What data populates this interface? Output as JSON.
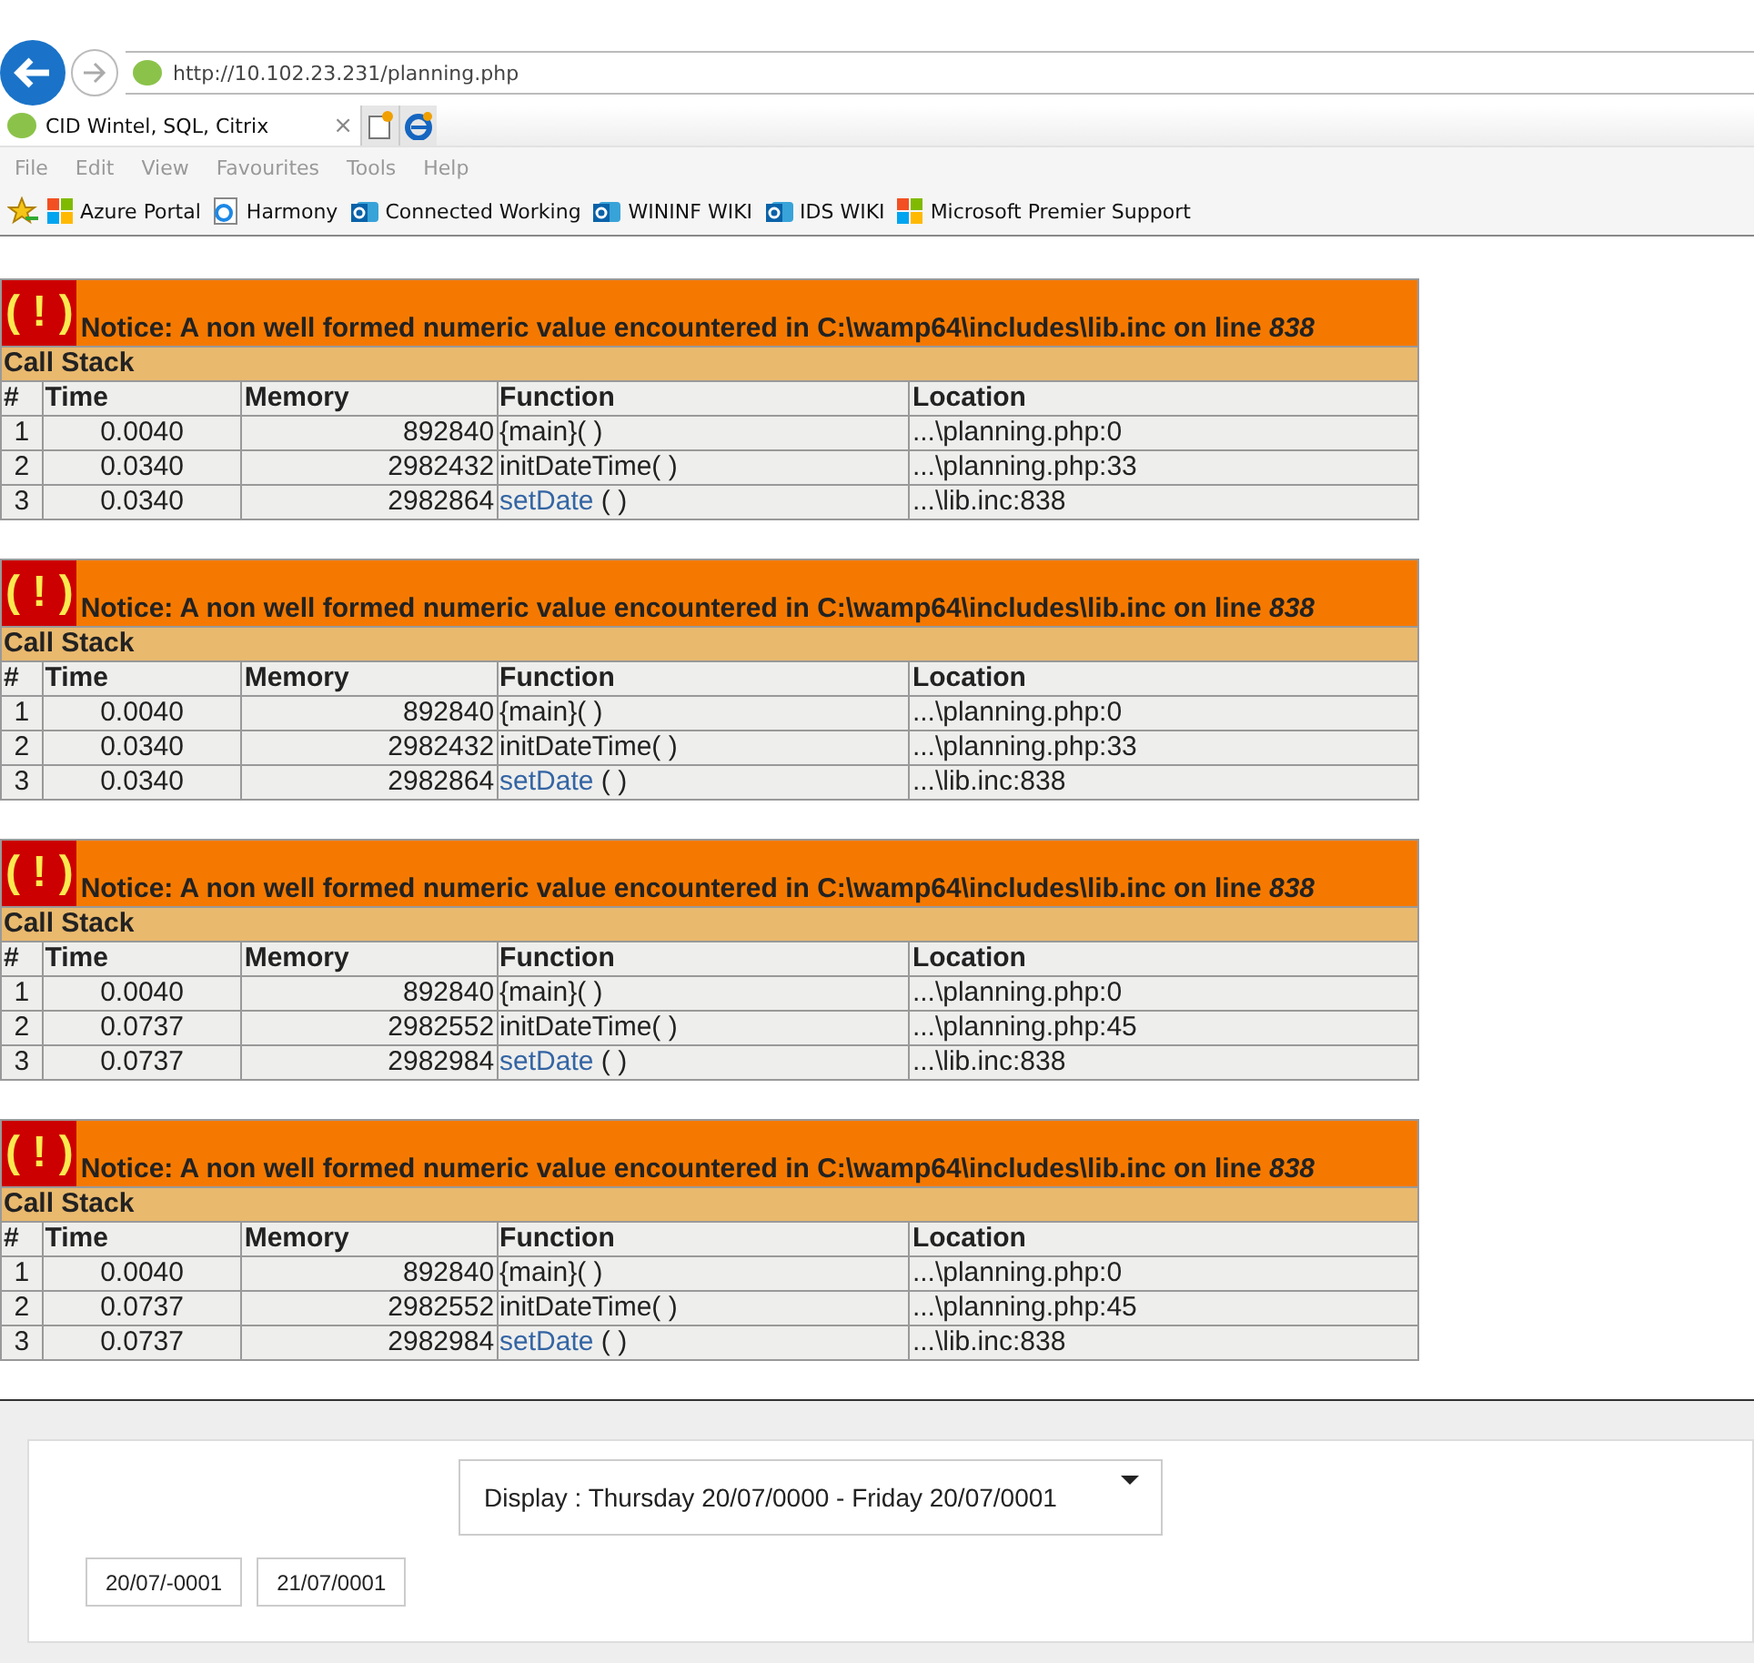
{
  "browser": {
    "address": "http://10.102.23.231/planning.php",
    "tab": {
      "title": "CID Wintel, SQL, Citrix",
      "close": "×"
    },
    "menu": [
      "File",
      "Edit",
      "View",
      "Favourites",
      "Tools",
      "Help"
    ],
    "favourites": [
      {
        "label": "Azure Portal",
        "kind": "windows"
      },
      {
        "label": "Harmony",
        "kind": "page"
      },
      {
        "label": "Connected Working",
        "kind": "sharepoint"
      },
      {
        "label": "WININF WIKI",
        "kind": "sharepoint"
      },
      {
        "label": "IDS WIKI",
        "kind": "sharepoint"
      },
      {
        "label": "Microsoft Premier Support",
        "kind": "windows"
      }
    ]
  },
  "notices": [
    {
      "badge": "( ! )",
      "message": "Notice: A non well formed numeric value encountered in C:\\wamp64\\includes\\lib.inc on line *838*",
      "stack_title": "Call Stack",
      "columns": [
        "#",
        "Time",
        "Memory",
        "Function",
        "Location"
      ],
      "rows": [
        {
          "num": "1",
          "time": "0.0040",
          "memory": "892840",
          "function": "{main}",
          "linked": false,
          "args": "( )",
          "location": "...\\planning.php:0"
        },
        {
          "num": "2",
          "time": "0.0340",
          "memory": "2982432",
          "function": "initDateTime",
          "linked": false,
          "args": "( )",
          "location": "...\\planning.php:33"
        },
        {
          "num": "3",
          "time": "0.0340",
          "memory": "2982864",
          "function": "setDate",
          "linked": true,
          "args": " ( )",
          "location": "...\\lib.inc:838"
        }
      ]
    },
    {
      "badge": "( ! )",
      "message": "Notice: A non well formed numeric value encountered in C:\\wamp64\\includes\\lib.inc on line *838*",
      "stack_title": "Call Stack",
      "columns": [
        "#",
        "Time",
        "Memory",
        "Function",
        "Location"
      ],
      "rows": [
        {
          "num": "1",
          "time": "0.0040",
          "memory": "892840",
          "function": "{main}",
          "linked": false,
          "args": "( )",
          "location": "...\\planning.php:0"
        },
        {
          "num": "2",
          "time": "0.0340",
          "memory": "2982432",
          "function": "initDateTime",
          "linked": false,
          "args": "( )",
          "location": "...\\planning.php:33"
        },
        {
          "num": "3",
          "time": "0.0340",
          "memory": "2982864",
          "function": "setDate",
          "linked": true,
          "args": " ( )",
          "location": "...\\lib.inc:838"
        }
      ]
    },
    {
      "badge": "( ! )",
      "message": "Notice: A non well formed numeric value encountered in C:\\wamp64\\includes\\lib.inc on line *838*",
      "stack_title": "Call Stack",
      "columns": [
        "#",
        "Time",
        "Memory",
        "Function",
        "Location"
      ],
      "rows": [
        {
          "num": "1",
          "time": "0.0040",
          "memory": "892840",
          "function": "{main}",
          "linked": false,
          "args": "( )",
          "location": "...\\planning.php:0"
        },
        {
          "num": "2",
          "time": "0.0737",
          "memory": "2982552",
          "function": "initDateTime",
          "linked": false,
          "args": "( )",
          "location": "...\\planning.php:45"
        },
        {
          "num": "3",
          "time": "0.0737",
          "memory": "2982984",
          "function": "setDate",
          "linked": true,
          "args": " ( )",
          "location": "...\\lib.inc:838"
        }
      ]
    },
    {
      "badge": "( ! )",
      "message": "Notice: A non well formed numeric value encountered in C:\\wamp64\\includes\\lib.inc on line *838*",
      "stack_title": "Call Stack",
      "columns": [
        "#",
        "Time",
        "Memory",
        "Function",
        "Location"
      ],
      "rows": [
        {
          "num": "1",
          "time": "0.0040",
          "memory": "892840",
          "function": "{main}",
          "linked": false,
          "args": "( )",
          "location": "...\\planning.php:0"
        },
        {
          "num": "2",
          "time": "0.0737",
          "memory": "2982552",
          "function": "initDateTime",
          "linked": false,
          "args": "( )",
          "location": "...\\planning.php:45"
        },
        {
          "num": "3",
          "time": "0.0737",
          "memory": "2982984",
          "function": "setDate",
          "linked": true,
          "args": " ( )",
          "location": "...\\lib.inc:838"
        }
      ]
    }
  ],
  "planning": {
    "display": "Display : Thursday 20/07/0000 - Friday 20/07/0001",
    "dates": [
      "20/07/-0001",
      "21/07/0001"
    ]
  }
}
